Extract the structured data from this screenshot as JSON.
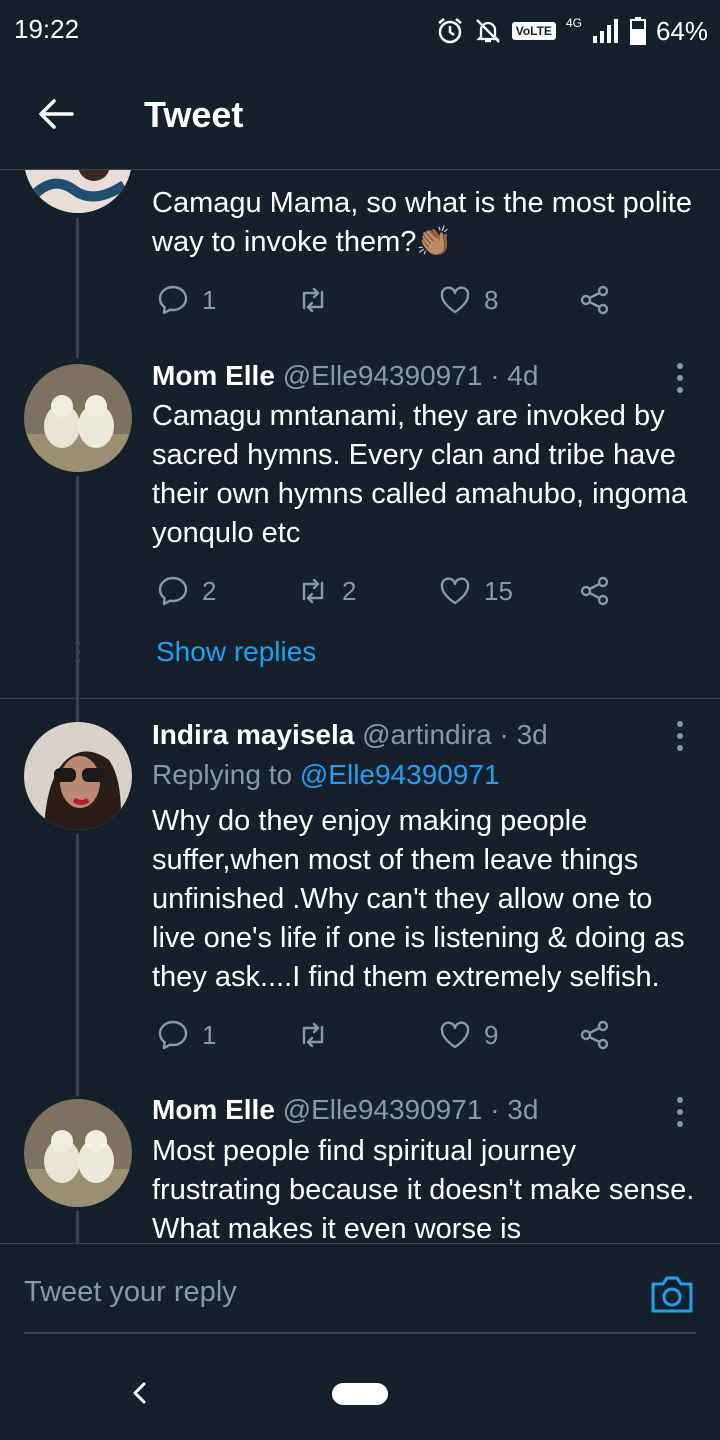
{
  "status_bar": {
    "time": "19:22",
    "network": "4G",
    "volte": "VoLTE",
    "battery": "64%"
  },
  "header": {
    "title": "Tweet"
  },
  "tweets": [
    {
      "text": "Camagu Mama, so what is the most polite way to invoke them?👏🏽",
      "replies": "1",
      "retweets": "",
      "likes": "8"
    },
    {
      "name": "Mom Elle",
      "handle": "@Elle94390971",
      "time": "· 4d",
      "text": "Camagu mntanami, they are invoked by sacred hymns. Every clan and tribe have their own hymns called amahubo, ingoma yonqulo etc",
      "replies": "2",
      "retweets": "2",
      "likes": "15"
    },
    {
      "name": "Indira mayisela",
      "handle": "@artindira",
      "time": "· 3d",
      "replying_prefix": "Replying to ",
      "replying_handle": "@Elle94390971",
      "text": "Why do they enjoy making people suffer,when most of them leave things unfinished .Why can't they allow one to live one's life if one is listening & doing as they ask....I find them extremely selfish.",
      "replies": "1",
      "retweets": "",
      "likes": "9"
    },
    {
      "name": "Mom Elle",
      "handle": "@Elle94390971",
      "time": "· 3d",
      "text": "Most people find spiritual journey frustrating because it doesn't make sense. What makes it even worse is"
    }
  ],
  "show_replies": "Show replies",
  "composer": {
    "placeholder": "Tweet your reply"
  },
  "colors": {
    "background": "#15202b",
    "accent": "#1da1f2",
    "muted": "#8899a6",
    "divider": "#38444d"
  }
}
